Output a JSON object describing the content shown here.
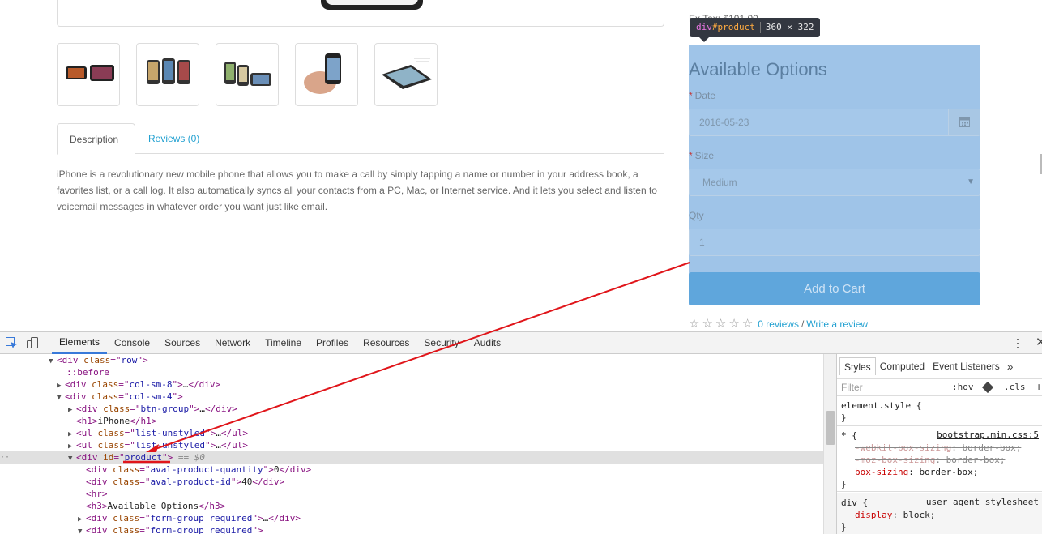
{
  "page": {
    "price_ex_tax": "Ex Tax: $101.00",
    "thumbnails": [
      "thumbnail-1",
      "thumbnail-2",
      "thumbnail-3",
      "thumbnail-4",
      "thumbnail-5"
    ],
    "tabs": {
      "description": "Description",
      "reviews": "Reviews (0)"
    },
    "description": "iPhone is a revolutionary new mobile phone that allows you to make a call by simply tapping a name or number in your address book, a favorites list, or a call log. It also automatically syncs all your contacts from a PC, Mac, or Internet service. And it lets you select and listen to voicemail messages in whatever order you want just like email.",
    "inspect_tooltip": {
      "tag": "div",
      "id": "#product",
      "size": "360 × 322"
    },
    "options": {
      "title": "Available Options",
      "date_label": "Date",
      "date_value": "2016-05-23",
      "size_label": "Size",
      "size_value": "Medium",
      "qty_label": "Qty",
      "qty_value": "1",
      "cart_label": "Add to Cart"
    },
    "rating": {
      "reviews_link": "0 reviews",
      "separator": "/",
      "write_link": "Write a review"
    }
  },
  "devtools": {
    "tabs": [
      "Elements",
      "Console",
      "Sources",
      "Network",
      "Timeline",
      "Profiles",
      "Resources",
      "Security",
      "Audits"
    ],
    "active_tab": "Elements",
    "dom_lines": [
      {
        "indent": 60,
        "tri": "▼",
        "html": "row-open"
      },
      {
        "indent": 82,
        "tri": "",
        "text": "::before"
      },
      {
        "indent": 70,
        "tri": "▶",
        "html": "col-sm-8"
      },
      {
        "indent": 70,
        "tri": "▼",
        "html": "col-sm-4"
      },
      {
        "indent": 84,
        "tri": "▶",
        "html": "btn-group"
      },
      {
        "indent": 94,
        "tri": "",
        "html": "h1"
      },
      {
        "indent": 84,
        "tri": "▶",
        "html": "ul-1"
      },
      {
        "indent": 84,
        "tri": "▶",
        "html": "ul-2"
      },
      {
        "indent": 84,
        "tri": "▼",
        "html": "product"
      },
      {
        "indent": 106,
        "tri": "",
        "html": "qty-div"
      },
      {
        "indent": 106,
        "tri": "",
        "html": "id-div"
      },
      {
        "indent": 106,
        "tri": "",
        "html": "hr"
      },
      {
        "indent": 106,
        "tri": "",
        "html": "h3"
      },
      {
        "indent": 96,
        "tri": "▶",
        "html": "fg-1"
      },
      {
        "indent": 96,
        "tri": "▼",
        "html": "fg-2"
      }
    ],
    "dom": {
      "row_class": "row",
      "pseudo": "::before",
      "col8_class": "col-sm-8",
      "col4_class": "col-sm-4",
      "btn_group_class": "btn-group",
      "h1_text": "iPhone",
      "ul_class": "list-unstyled",
      "product_id": "product",
      "product_suffix": " == $0",
      "qty_class": "aval-product-quantity",
      "qty_val": "0",
      "id_class": "aval-product-id",
      "id_val": "40",
      "h3_text": "Available Options",
      "fg_class": "form-group required"
    },
    "styles": {
      "tabs": [
        "Styles",
        "Computed",
        "Event Listeners"
      ],
      "filter_placeholder": "Filter",
      "hov": ":hov",
      "cls": ".cls",
      "element_style": "element.style {",
      "close_brace": "}",
      "star_rule": "* {",
      "star_source": "bootstrap.min.css:5",
      "webkit_prop": "-webkit-box-sizing",
      "moz_prop": "-moz-box-sizing",
      "box_prop": "box-sizing",
      "box_val": "border-box;",
      "div_rule": "div {",
      "div_source": "user agent stylesheet",
      "display_prop": "display",
      "display_val": "block;"
    }
  },
  "colors": {
    "highlight": "#9fc4e8",
    "link": "#23a1d1",
    "arrow": "#e0151a"
  }
}
